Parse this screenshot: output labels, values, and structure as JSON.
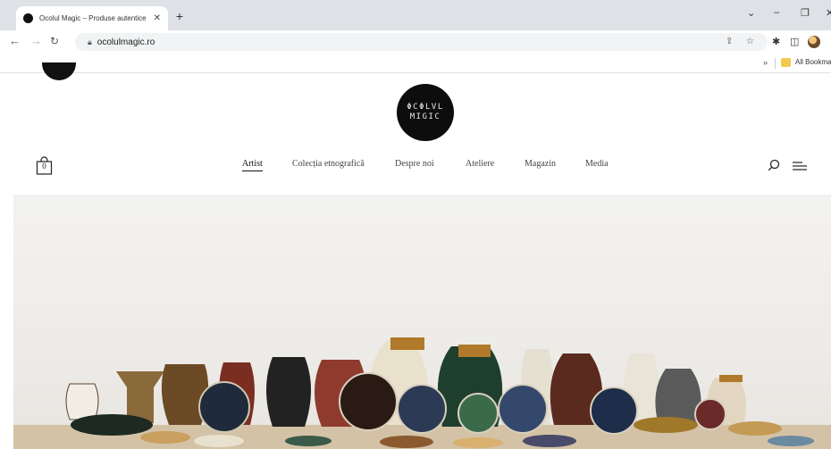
{
  "browser": {
    "tab_title": "Ocolul Magic – Produse autentice",
    "tab_close": "✕",
    "new_tab": "+",
    "url": "ocolulmagic.ro",
    "bookmarks_label": "All Bookmarks",
    "bookmarks_chevron": "»"
  },
  "site": {
    "logo_line1": "ΦCΦLVL",
    "logo_line2": "MIGIC",
    "cart_count": "0",
    "nav": [
      {
        "label": "Artist",
        "active": true
      },
      {
        "label": "Colecția etnografică",
        "active": false
      },
      {
        "label": "Despre noi",
        "active": false
      },
      {
        "label": "Ateliere",
        "active": false
      },
      {
        "label": "Magazin",
        "active": false
      },
      {
        "label": "Media",
        "active": false
      }
    ]
  },
  "icons": {
    "back": "back-arrow-icon",
    "forward": "forward-arrow-icon",
    "reload": "reload-icon",
    "lock": "lock-icon",
    "share": "share-icon",
    "star": "star-icon",
    "extensions": "puzzle-icon",
    "sidebar": "sidebar-icon",
    "cart": "shopping-bag-icon",
    "search": "search-icon",
    "menu": "menu-icon"
  },
  "colors": {
    "chrome_bg": "#dee1e6",
    "logo_bg": "#0d0d0d",
    "wall": "#f0eeeb",
    "shelf": "#d3c2a5"
  }
}
